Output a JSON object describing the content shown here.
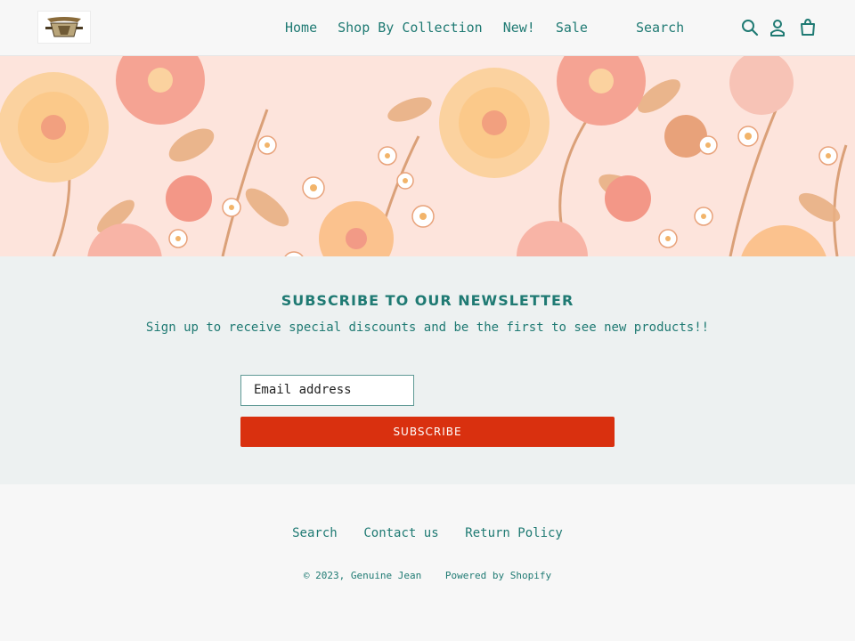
{
  "header": {
    "nav": [
      "Home",
      "Shop By Collection",
      "New!",
      "Sale"
    ],
    "search_label": "Search",
    "icons": [
      "search-icon",
      "account-icon",
      "cart-icon"
    ]
  },
  "hero": {
    "palette": [
      "#fde4dc",
      "#fbcf9f",
      "#f59a8c",
      "#e7a87a",
      "#f9b7a5"
    ]
  },
  "newsletter": {
    "title": "SUBSCRIBE TO OUR NEWSLETTER",
    "subtitle": "Sign up to receive special discounts and be the first to see new products!!",
    "email_placeholder": "Email address",
    "button_label": "SUBSCRIBE"
  },
  "footer": {
    "links": [
      "Search",
      "Contact us",
      "Return Policy"
    ],
    "copyright": "© 2023, Genuine Jean",
    "powered": "Powered by Shopify"
  },
  "colors": {
    "accent": "#1f7a73",
    "button": "#d9300f",
    "newsletter_bg": "#edf1f1"
  }
}
